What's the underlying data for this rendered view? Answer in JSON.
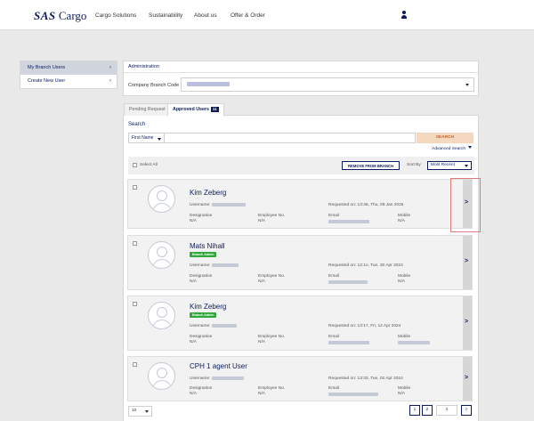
{
  "brand": {
    "logo_mark": "SAS",
    "logo_text": "Cargo"
  },
  "nav": {
    "items": [
      "Cargo Solutions",
      "Sustainability",
      "About us",
      "Offer & Order"
    ]
  },
  "sidebar": {
    "items": [
      {
        "label": "My Branch Users",
        "chevron": "›"
      },
      {
        "label": "Create New User",
        "chevron": "›"
      }
    ]
  },
  "admin": {
    "header": "Administration",
    "branch_label": "Company Branch Code"
  },
  "tabs": {
    "pending": "Pending Request",
    "approved": "Approved Users",
    "approved_count": "11"
  },
  "search": {
    "label": "Search",
    "filter": "First Name",
    "button": "SEARCH",
    "advanced": "Advanced Search"
  },
  "actions": {
    "select_all": "Select All",
    "remove": "REMOVE FROM BRANCH",
    "sort_by": "Sort By",
    "sort_value": "Most Recent"
  },
  "field_labels": {
    "username": "Username:",
    "designation": "Designation",
    "employee_no": "Employee No.",
    "email": "Email",
    "mobile": "Mobile"
  },
  "users": [
    {
      "name": "Kim Zeberg",
      "badge": "",
      "requested": "Requested on: 13:46, Thu, 09 Jan 2025",
      "designation": "N/A",
      "employee_no": "N/A",
      "mobile": "N/A"
    },
    {
      "name": "Mats Nihall",
      "badge": "Branch Admin",
      "requested": "Requested on: 12:1o, Tue, 30 Apr 2024",
      "designation": "N/A",
      "employee_no": "N/A",
      "mobile": "N/A"
    },
    {
      "name": "Kim Zeberg",
      "badge": "Branch Admin",
      "requested": "Requested on: 13:17, Fri, 12 Apr 2024",
      "designation": "N/A",
      "employee_no": "N/A",
      "mobile": ""
    },
    {
      "name": "CPH 1 agent User",
      "badge": "",
      "requested": "Requested on: 13:33, Tue, 02 Apr 2024",
      "designation": "N/A",
      "employee_no": "N/A",
      "mobile": "N/A"
    }
  ],
  "pagination": {
    "per_page": "10",
    "pages": [
      "1",
      "2",
      "3"
    ]
  },
  "colors": {
    "brand_navy": "#0a1c5c",
    "search_button_bg": "#f3d8bf",
    "badge_green": "#2fa83a",
    "highlight_red": "#e07a7a"
  }
}
